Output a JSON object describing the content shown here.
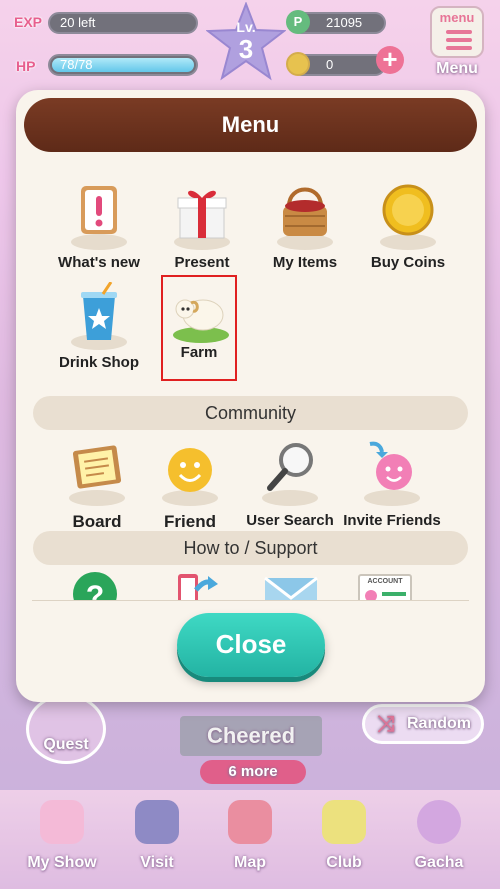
{
  "hud": {
    "exp_label": "EXP",
    "exp_value": "20 left",
    "hp_label": "HP",
    "hp_value": "78/78",
    "hp_fill": 1.0,
    "level_label": "Lv.",
    "level": "3",
    "points_symbol": "P",
    "points": "21095",
    "coins": "0",
    "menu_icon_text": "menu",
    "menu_label": "Menu"
  },
  "modal": {
    "title": "Menu",
    "main_items": [
      {
        "label": "What's new",
        "icon": "notice-icon"
      },
      {
        "label": "Present",
        "icon": "gift-icon"
      },
      {
        "label": "My Items",
        "icon": "basket-icon"
      },
      {
        "label": "Buy Coins",
        "icon": "coin-icon"
      },
      {
        "label": "Drink Shop",
        "icon": "drink-cup-icon"
      },
      {
        "label": "Farm",
        "icon": "sheep-icon",
        "selected": true
      }
    ],
    "community_title": "Community",
    "community_items": [
      {
        "label": "Board",
        "icon": "board-icon"
      },
      {
        "label": "Friend",
        "icon": "smiley-icon"
      },
      {
        "label": "User Search",
        "icon": "magnifier-icon"
      },
      {
        "label": "Invite Friends",
        "icon": "invite-icon"
      }
    ],
    "support_title": "How to / Support",
    "support_items": [
      {
        "icon": "help-icon"
      },
      {
        "icon": "transfer-icon"
      },
      {
        "icon": "mail-icon"
      },
      {
        "icon": "account-card-icon",
        "text": "ACCOUNT"
      }
    ],
    "close_label": "Close"
  },
  "background": {
    "quest_label": "Quest",
    "random_label": "Random",
    "cheered_label": "Cheered",
    "more_label": "6 more",
    "nav": [
      {
        "label": "My Show",
        "icon": "stage-icon"
      },
      {
        "label": "Visit",
        "icon": "door-icon"
      },
      {
        "label": "Map",
        "icon": "map-icon"
      },
      {
        "label": "Club",
        "icon": "club-icon"
      },
      {
        "label": "Gacha",
        "icon": "gacha-icon"
      }
    ]
  },
  "colors": {
    "accent_pink": "#e0336f",
    "header_brown": "#6b3220",
    "close_teal": "#2cc4b1",
    "selection_red": "#e02020"
  }
}
